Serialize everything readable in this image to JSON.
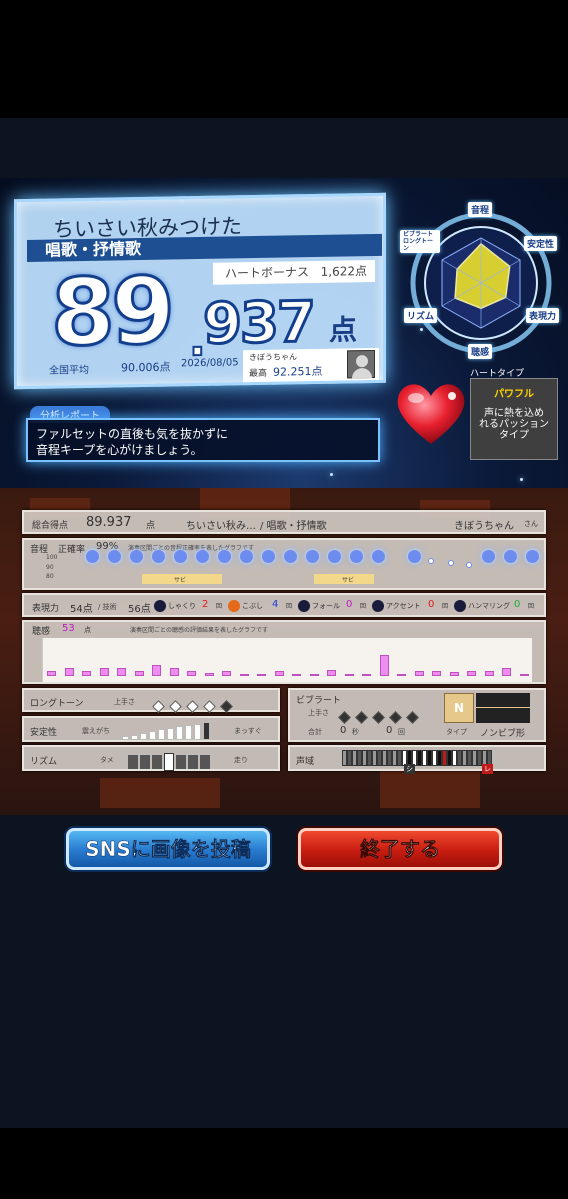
{
  "score_card": {
    "song_title": "ちいさい秋みつけた",
    "genre": "唱歌・抒情歌",
    "heart_bonus_label": "ハートボーナス",
    "heart_bonus_value": "1,622点",
    "score_int": "89",
    "score_dot": ".",
    "score_dec": "937",
    "score_unit": "点",
    "national_avg_label": "全国平均",
    "national_avg_value": "90.006点",
    "date": "2026/08/05",
    "user_name": "きぼうちゃん",
    "best_label": "最高",
    "best_value": "92.251点"
  },
  "analysis": {
    "tag": "分析レポート",
    "line1": "ファルセットの直後も気を抜かずに",
    "line2": "音程キープを心がけましょう。"
  },
  "radar": {
    "labels": [
      "音程",
      "安定性",
      "表現力",
      "聴感",
      "リズム",
      "ビブラート ロングトーン"
    ],
    "values": [
      0.85,
      0.72,
      0.62,
      0.55,
      0.65,
      0.6
    ]
  },
  "heart_type": {
    "label": "ハートタイプ",
    "name": "パワフル",
    "desc1": "声に熱を込め",
    "desc2": "れるパッション",
    "desc3": "タイプ"
  },
  "total": {
    "label": "総合得点",
    "score": "89.937",
    "unit": "点",
    "song": "ちいさい秋み…",
    "genre": "/ 唱歌・抒情歌",
    "user": "きぼうちゃん",
    "honorific": "さん"
  },
  "pitch": {
    "label": "音程",
    "accuracy_label": "正確率",
    "accuracy": "99%",
    "desc": "演奏区間ごとの音程正確率を表したグラフです",
    "y100": "100",
    "y90": "90",
    "y80": "80",
    "sabi1": "サビ",
    "sabi2": "サビ"
  },
  "expression": {
    "label": "表現力",
    "score": "54点",
    "per_label": "/ 技術",
    "count_label": "56点",
    "shakuri": "しゃくり",
    "shakuri_n": "2",
    "kobushi": "こぶし",
    "kobushi_n": "4",
    "fall": "フォール",
    "fall_n": "0",
    "accent": "アクセント",
    "accent_n": "0",
    "humming": "ハンマリング",
    "humming_n": "0",
    "unit": "回"
  },
  "emotion": {
    "label": "聴感",
    "score": "53",
    "unit": "点",
    "desc": "演奏区間ごとの聴感の評価結果を表したグラフです",
    "values": [
      0.12,
      0.2,
      0.12,
      0.2,
      0.22,
      0.12,
      0.28,
      0.2,
      0.12,
      0.08,
      0.12,
      0.06,
      0.04,
      0.12,
      0.05,
      0.05,
      0.15,
      0.05,
      0.05,
      0.55,
      0.05,
      0.12,
      0.12,
      0.1,
      0.12,
      0.12,
      0.2,
      0.05
    ]
  },
  "longtone": {
    "label": "ロングトーン",
    "level_label": "上手さ"
  },
  "stability": {
    "label": "安定性",
    "left": "震えがち",
    "right": "まっすぐ"
  },
  "rhythm": {
    "label": "リズム",
    "left": "タメ",
    "right": "走り"
  },
  "vibrato": {
    "label": "ビブラート",
    "level_label": "上手さ",
    "total_label": "合計",
    "seconds": "0",
    "seconds_unit": "秒",
    "count": "0",
    "count_unit": "回",
    "type_label": "タイプ",
    "type": "ノンビブ形",
    "badge": "N"
  },
  "range": {
    "label": "声域",
    "low": "シ",
    "high": "レ"
  },
  "buttons": {
    "sns": "SNSに画像を投稿",
    "end": "終了する"
  }
}
